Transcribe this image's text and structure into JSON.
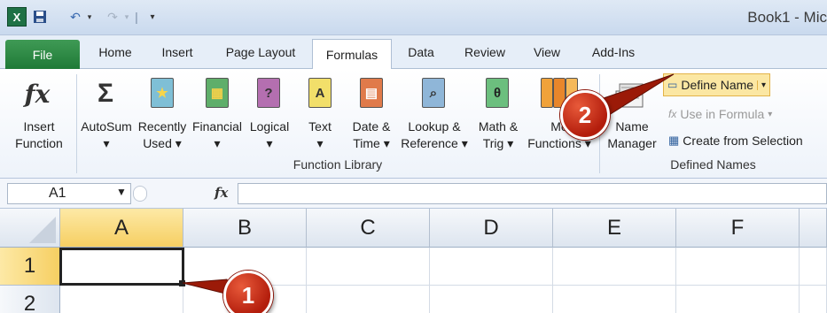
{
  "titlebar": {
    "title": "Book1 - Mic",
    "logo_icon": "excel-logo-icon",
    "save_icon": "save-icon",
    "undo_icon": "undo-icon",
    "redo_icon": "redo-icon"
  },
  "tabs": [
    "File",
    "Home",
    "Insert",
    "Page Layout",
    "Formulas",
    "Data",
    "Review",
    "View",
    "Add-Ins"
  ],
  "ribbon": {
    "function_library": {
      "label": "Function Library",
      "insert_function": [
        "Insert",
        "Function"
      ],
      "autosum": "AutoSum",
      "recently_used": [
        "Recently",
        "Used"
      ],
      "financial": "Financial",
      "logical": "Logical",
      "text": "Text",
      "date_time": [
        "Date &",
        "Time"
      ],
      "lookup_reference": [
        "Lookup &",
        "Reference"
      ],
      "math_trig": [
        "Math &",
        "Trig"
      ],
      "more_functions": [
        "Mo",
        "Functions"
      ]
    },
    "defined_names": {
      "label": "Defined Names",
      "name_manager": [
        "Name",
        "Manager"
      ],
      "define_name": "Define Name",
      "use_in_formula": "Use in Formula",
      "create_from_selection": "Create from Selection"
    }
  },
  "formula_bar": {
    "name_box": "A1",
    "fx_label": "fx",
    "content": ""
  },
  "grid": {
    "columns": [
      "A",
      "B",
      "C",
      "D",
      "E",
      "F"
    ],
    "rows": [
      "1",
      "2"
    ],
    "active_cell": "A1"
  },
  "callouts": {
    "one": "1",
    "two": "2"
  },
  "colors": {
    "file_tab": "#1f7a37",
    "selection_header": "#f6cf62",
    "callout": "#c0280f"
  }
}
